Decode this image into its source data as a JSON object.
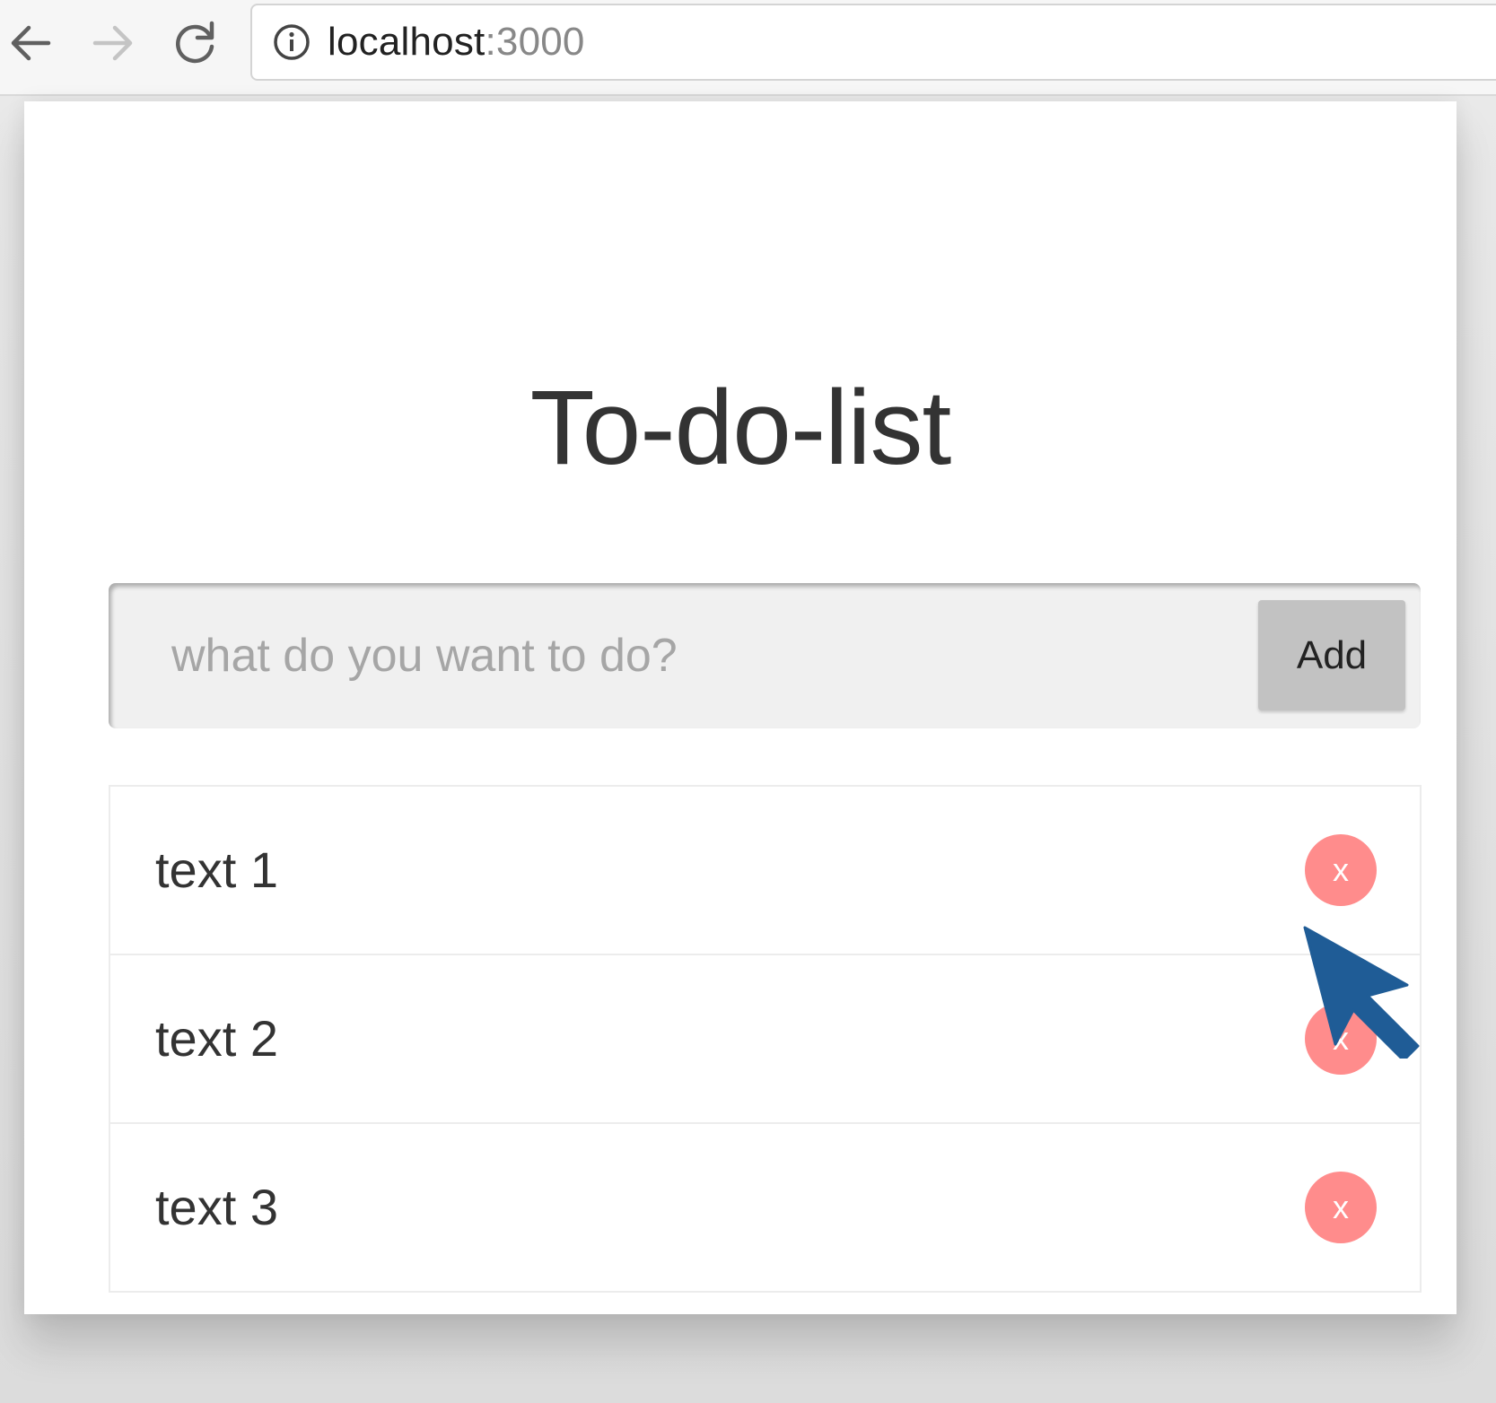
{
  "browser": {
    "url_host": "localhost",
    "url_port": ":3000"
  },
  "app": {
    "title": "To-do-list",
    "input": {
      "placeholder": "what do you want to do?",
      "value": ""
    },
    "add_button_label": "Add",
    "todos": [
      {
        "text": "text 1",
        "delete_label": "x"
      },
      {
        "text": "text 2",
        "delete_label": "x"
      },
      {
        "text": "text 3",
        "delete_label": "x"
      }
    ]
  },
  "icons": {
    "back": "arrow-left-icon",
    "forward": "arrow-right-icon",
    "reload": "reload-icon",
    "info": "info-icon",
    "cursor": "mouse-pointer-icon"
  },
  "colors": {
    "delete_button": "#ff8c8c",
    "add_button": "#c2c2c2",
    "input_background": "#f0f0f0",
    "cursor": "#1f5c96",
    "title_text": "#333333"
  }
}
